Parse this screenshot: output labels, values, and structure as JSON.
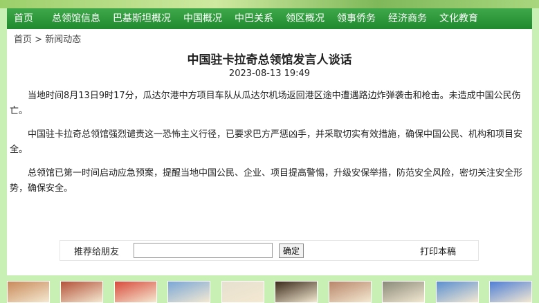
{
  "nav": {
    "items": [
      "首页",
      "总领馆信息",
      "巴基斯坦概况",
      "中国概况",
      "中巴关系",
      "领区概况",
      "领事侨务",
      "经济商务",
      "文化教育"
    ]
  },
  "breadcrumb": {
    "home": "首页",
    "separator": ">",
    "current": "新闻动态"
  },
  "article": {
    "title": "中国驻卡拉奇总领馆发言人谈话",
    "datetime": "2023-08-13 19:49",
    "paragraphs": [
      "当地时间8月13日9时17分，瓜达尔港中方项目车队从瓜达尔机场返回港区途中遭遇路边炸弹袭击和枪击。未造成中国公民伤亡。",
      "中国驻卡拉奇总领馆强烈谴责这一恐怖主义行径，已要求巴方严惩凶手，并采取切实有效措施，确保中国公民、机构和项目安全。",
      "总领馆已第一时间启动应急预案，提醒当地中国公民、企业、项目提高警惕，升级安保举措，防范安全风险，密切关注安全形势，确保安全。"
    ]
  },
  "share": {
    "label": "推荐给朋友",
    "input_value": "",
    "confirm_label": "确定",
    "print_label": "打印本稿"
  },
  "thumbnails": [
    {
      "icon": "palace-photo",
      "color": "#c98a5a"
    },
    {
      "icon": "mosque-photo",
      "color": "#b4533a"
    },
    {
      "icon": "opera-photo",
      "color": "#d94b3c"
    },
    {
      "icon": "city-photo",
      "color": "#7aa7d6"
    },
    {
      "icon": "temple-of-heaven-photo",
      "color": "#e6e0cf"
    },
    {
      "icon": "statue-photo",
      "color": "#3a2a1a"
    },
    {
      "icon": "elder-portrait-photo",
      "color": "#b8866a"
    },
    {
      "icon": "sculpture-photo",
      "color": "#8a8a7a"
    },
    {
      "icon": "pagoda-photo",
      "color": "#5a8fd0"
    },
    {
      "icon": "temple-of-heaven-sky-photo",
      "color": "#4f7fd6"
    }
  ]
}
